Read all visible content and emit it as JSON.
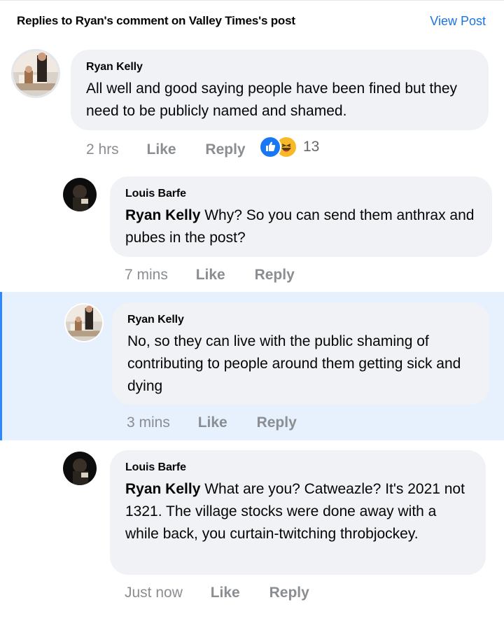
{
  "header": {
    "title": "Replies to Ryan's comment on Valley Times's post",
    "view_post": "View Post"
  },
  "comments": [
    {
      "author": "Ryan Kelly",
      "mention": "",
      "text": "All well and good saying people have been fined but they need to be publicly named and shamed.",
      "time": "2 hrs",
      "like": "Like",
      "reply": "Reply",
      "reactions": {
        "icons": [
          "like-icon",
          "haha-icon"
        ],
        "count": "13"
      }
    },
    {
      "author": "Louis Barfe",
      "mention": "Ryan Kelly",
      "text": " Why? So you can send them anthrax and pubes in the post?",
      "time": "7 mins",
      "like": "Like",
      "reply": "Reply"
    },
    {
      "author": "Ryan Kelly",
      "mention": "",
      "text": "No, so they can live with the public shaming of contributing to people around them getting sick and dying",
      "time": "3 mins",
      "like": "Like",
      "reply": "Reply",
      "highlighted": true
    },
    {
      "author": "Louis Barfe",
      "mention": "Ryan Kelly",
      "text": " What are you? Catweazle? It's 2021 not 1321. The village stocks were done away with a while back, you curtain-twitching throbjockey.",
      "time": "Just now",
      "like": "Like",
      "reply": "Reply"
    }
  ],
  "colors": {
    "link": "#1b74e4",
    "bubble": "#f0f2f5",
    "highlight": "#e7f0fd",
    "accent": "#2d88ff",
    "meta": "#8a8d91"
  }
}
